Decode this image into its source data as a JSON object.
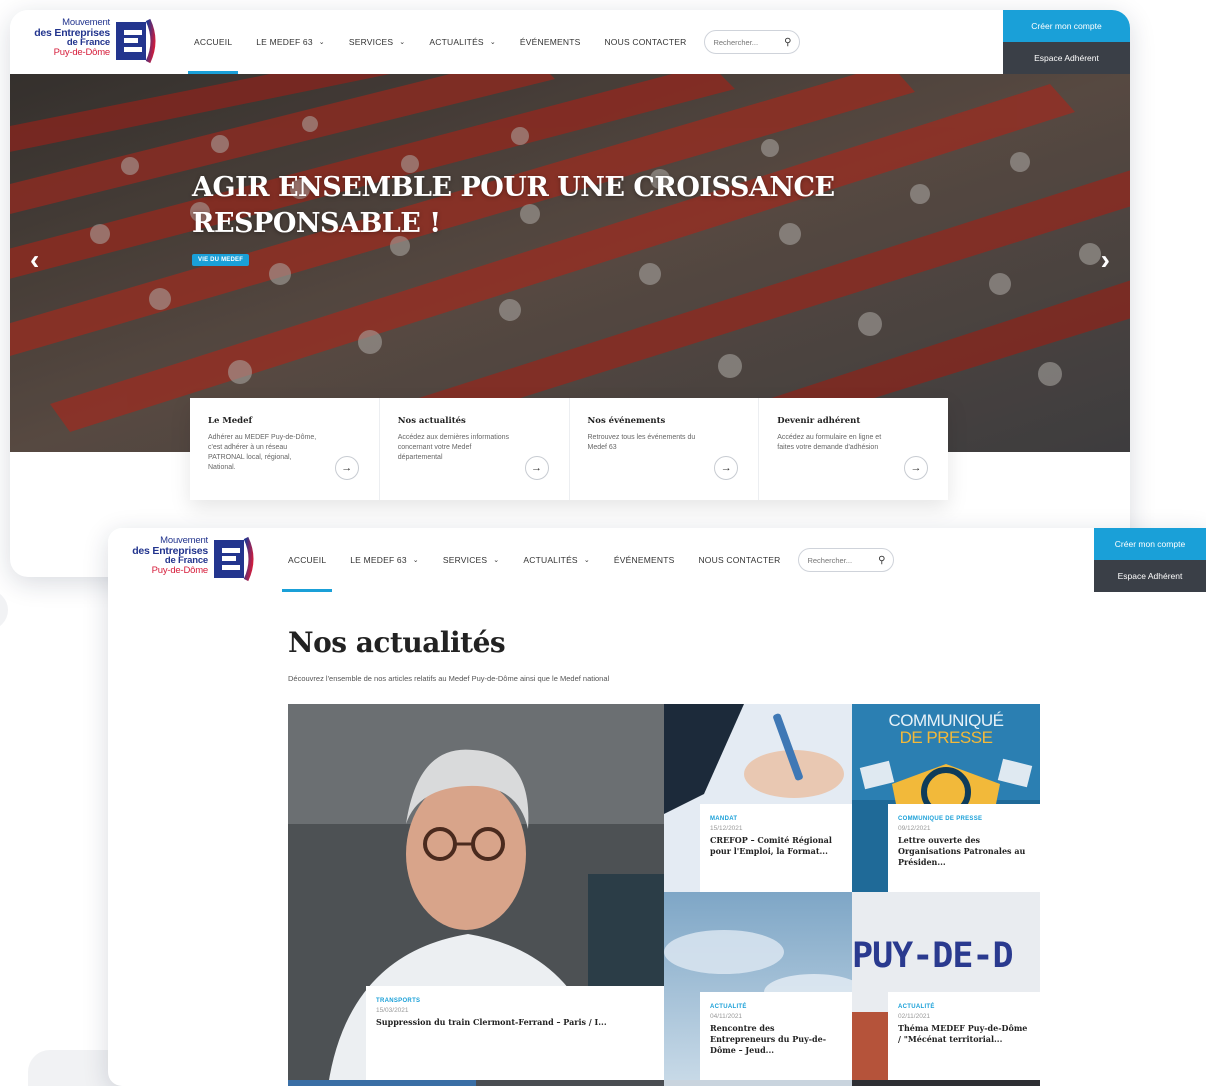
{
  "brand": {
    "line1": "Mouvement",
    "line2": "des Entreprises",
    "line3": "de France",
    "line4": "Puy-de-Dôme",
    "colors": {
      "blue": "#1aa0d8",
      "navy": "#23358e",
      "red": "#d61c3a",
      "dark": "#3a3f47"
    }
  },
  "nav": {
    "items": [
      {
        "label": "ACCUEIL",
        "dropdown": false,
        "active": true
      },
      {
        "label": "LE MEDEF 63",
        "dropdown": true
      },
      {
        "label": "SERVICES",
        "dropdown": true
      },
      {
        "label": "ACTUALITÉS",
        "dropdown": true
      },
      {
        "label": "ÉVÉNEMENTS",
        "dropdown": false
      },
      {
        "label": "NOUS CONTACTER",
        "dropdown": false
      }
    ],
    "search_placeholder": "Rechercher...",
    "create_account": "Créer mon compte",
    "member_space": "Espace Adhérent"
  },
  "hero": {
    "title": "AGIR ENSEMBLE POUR UNE CROISSANCE RESPONSABLE !",
    "tag": "VIE DU MEDEF",
    "prev_icon": "chevron-left-icon",
    "next_icon": "chevron-right-icon"
  },
  "tiles": [
    {
      "title": "Le Medef",
      "text": "Adhérer au MEDEF Puy-de-Dôme, c'est adhérer à un réseau PATRONAL local, régional, National."
    },
    {
      "title": "Nos actualités",
      "text": "Accédez aux dernières informations concernant votre Medef départemental"
    },
    {
      "title": "Nos événements",
      "text": "Retrouvez tous les événements du Medef 63"
    },
    {
      "title": "Devenir adhérent",
      "text": "Accédez au formulaire en ligne et faites votre demande d'adhésion"
    }
  ],
  "news": {
    "title": "Nos actualités",
    "subtitle": "Découvrez l'ensemble de nos articles relatifs au Medef Puy-de-Dôme ainsi que le Medef national",
    "featured": {
      "category": "TRANSPORTS",
      "date": "15/03/2021",
      "title": "Suppression du train Clermont-Ferrand – Paris / I..."
    },
    "articles": [
      {
        "category": "MANDAT",
        "date": "15/12/2021",
        "title": "CREFOP – Comité Régional pour l'Emploi, la Format..."
      },
      {
        "category": "COMMUNIQUE DE PRESSE",
        "date": "09/12/2021",
        "title": "Lettre ouverte des Organisations Patronales au Présiden..."
      },
      {
        "category": "ACTUALITÉ",
        "date": "04/11/2021",
        "title": "Rencontre des Entrepreneurs du Puy-de-Dôme – Jeud..."
      },
      {
        "category": "ACTUALITÉ",
        "date": "02/11/2021",
        "title": "Théma MEDEF Puy-de-Dôme / \"Mécénat territorial..."
      }
    ],
    "press_image_text": {
      "line1": "COMMUNIQUÉ",
      "line2": "DE PRESSE"
    },
    "puy_image_text": "PUY-DE-D"
  }
}
